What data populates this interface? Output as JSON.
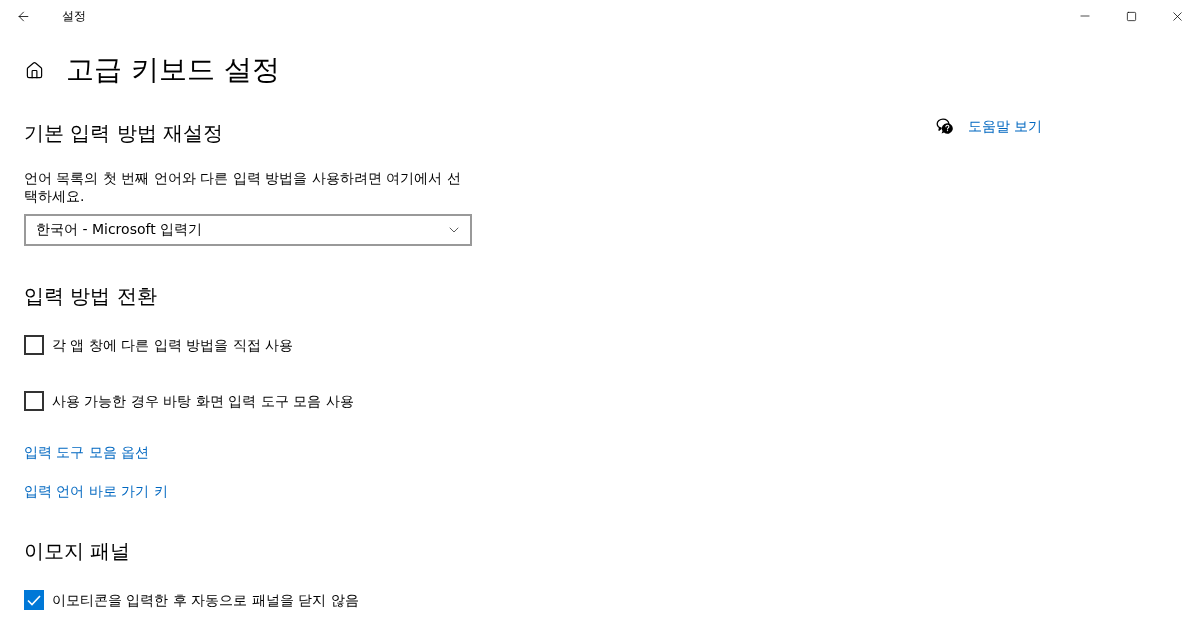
{
  "window": {
    "title": "설정"
  },
  "page": {
    "title": "고급 키보드 설정"
  },
  "help_link": {
    "label": "도움말 보기"
  },
  "sections": [
    {
      "heading": "기본 입력 방법 재설정",
      "items": [
        {
          "kind": "description",
          "text": "언어 목록의 첫 번째 언어와 다른 입력 방법을 사용하려면 여기에서 선택하세요."
        },
        {
          "kind": "dropdown",
          "value": "한국어 - Microsoft 입력기"
        }
      ]
    },
    {
      "heading": "입력 방법 전환",
      "items": [
        {
          "kind": "checkbox",
          "label": "각 앱 창에 다른 입력 방법을 직접 사용",
          "checked": false
        },
        {
          "kind": "checkbox",
          "label": "사용 가능한 경우 바탕 화면 입력 도구 모음 사용",
          "checked": false
        },
        {
          "kind": "link",
          "label": "입력 도구 모음 옵션"
        },
        {
          "kind": "link",
          "label": "입력 언어 바로 가기 키"
        }
      ]
    },
    {
      "heading": "이모지 패널",
      "items": [
        {
          "kind": "checkbox",
          "label": "이모티콘을 입력한 후 자동으로 패널을 닫지 않음",
          "checked": true
        }
      ]
    }
  ]
}
